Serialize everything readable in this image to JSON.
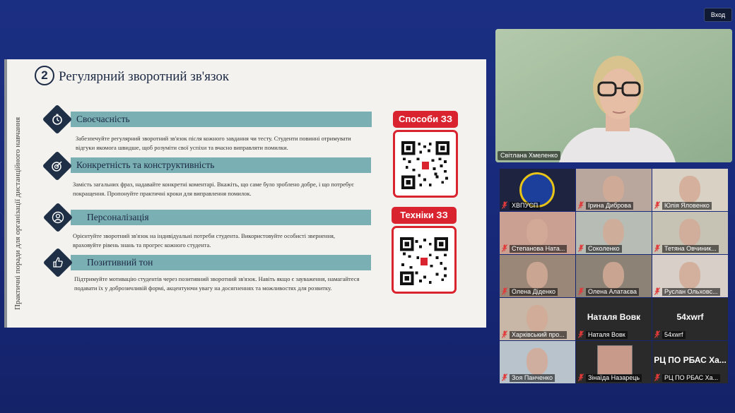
{
  "header": {
    "enter_button": "Вход"
  },
  "slide": {
    "number": "2",
    "title": "Регулярний зворотний зв'язок",
    "vertical_caption": "Практичні поради для організації дистанційного навчання",
    "tips": [
      {
        "title": "Своєчасність",
        "text": "Забезпечуйте регулярний зворотний зв'язок після кожного завдання чи тесту. Студенти повинні отримувати відгуки якомога швидше, щоб розуміти свої успіхи та вчасно виправляти помилки."
      },
      {
        "title": "Конкретність та конструктивність",
        "text": "Замість загальних фраз, надавайте конкретні коментарі. Вкажіть, що саме було зроблено добре, і що потребує покращення. Пропонуйте практичні кроки для виправлення помилок."
      },
      {
        "title": "Персоналізація",
        "text": "Орієнтуйте зворотний зв'язок на індивідуальні потреби студента. Використовуйте особисті звернення, враховуйте рівень знань та прогрес кожного студента."
      },
      {
        "title": "Позитивний тон",
        "text": "Підтримуйте мотивацію студентів через позитивний зворотний зв'язок. Навіть якщо є зауваження, намагайтеся подавати їх у доброзичливій формі, акцентуючи увагу на досягненнях та можливостях для розвитку."
      }
    ],
    "qr_cards": [
      {
        "label": "Способи ЗЗ"
      },
      {
        "label": "Техніки ЗЗ"
      }
    ]
  },
  "speaker": {
    "name": "Світлана Хмеленко"
  },
  "participants": [
    {
      "name": "ХВПУСП",
      "big": ""
    },
    {
      "name": "Ірина Диброва",
      "big": ""
    },
    {
      "name": "Юлія Яловенко",
      "big": ""
    },
    {
      "name": "Степанова Ната...",
      "big": ""
    },
    {
      "name": "Соколенко",
      "big": ""
    },
    {
      "name": "Тетяна Овчиник...",
      "big": ""
    },
    {
      "name": "Олена Діденко",
      "big": ""
    },
    {
      "name": "Олена Алатаєва",
      "big": ""
    },
    {
      "name": "Руслан Ольховс...",
      "big": ""
    },
    {
      "name": "Харківський про...",
      "big": ""
    },
    {
      "name": "Наталя Вовк",
      "big": "Наталя Вовк"
    },
    {
      "name": "54xwrf",
      "big": "54xwrf"
    },
    {
      "name": "Зоя Панченко",
      "big": ""
    },
    {
      "name": "Зінаїда Назарець",
      "big": ""
    },
    {
      "name": "РЦ ПО РБАС Ха...",
      "big": "РЦ ПО РБАС Ха..."
    }
  ],
  "colors": {
    "accent_teal": "#7aafb3",
    "qr_red": "#d9232f",
    "navy": "#1c2a45",
    "background": "#1b2f82"
  }
}
